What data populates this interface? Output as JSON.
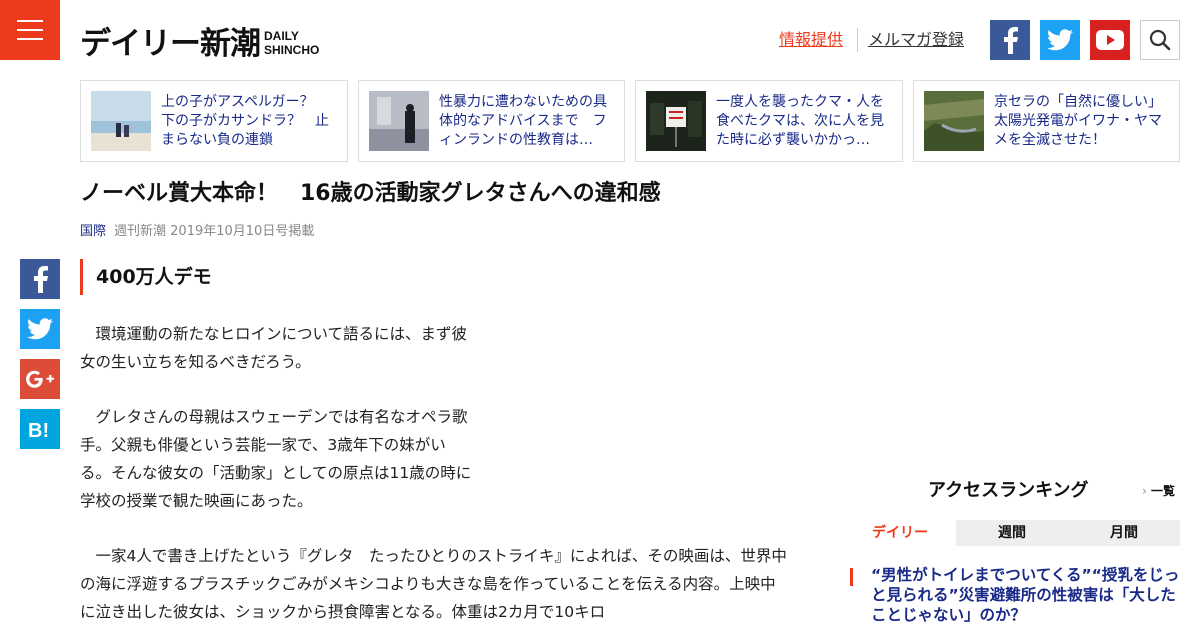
{
  "header": {
    "logo_jp": "デイリー新潮",
    "logo_en_1": "DAILY",
    "logo_en_2": "SHINCHO",
    "info_link": "情報提供",
    "newsletter_link": "メルマガ登録"
  },
  "related": [
    {
      "text": "上の子がアスペルガー？　下の子がカサンドラ？　止まらない負の連鎖"
    },
    {
      "text": "性暴力に遭わないための具体的なアドバイスまで　フィンランドの性教育は…"
    },
    {
      "text": "一度人を襲ったクマ・人を食べたクマは、次に人を見た時に必ず襲いかかっ…"
    },
    {
      "text": "京セラの「自然に優しい」太陽光発電がイワナ・ヤマメを全滅させた！"
    }
  ],
  "article": {
    "title": "ノーベル賞大本命！　16歳の活動家グレタさんへの違和感",
    "category": "国際",
    "source": "週刊新潮 2019年10月10日号掲載",
    "subhead": "400万人デモ",
    "paragraphs": [
      "　環境運動の新たなヒロインについて語るには、まず彼女の生い立ちを知るべきだろう。",
      "　グレタさんの母親はスウェーデンでは有名なオペラ歌手。父親も俳優という芸能一家で、3歳年下の妹がいる。そんな彼女の「活動家」としての原点は11歳の時に学校の授業で観た映画にあった。",
      "　一家4人で書き上げたという『グレタ　たったひとりのストライキ』によれば、その映画は、世界中の海に浮遊するプラスチックごみがメキシコよりも大きな島を作っていることを伝える内容。上映中に泣き出した彼女は、ショックから摂食障害となる。体重は2カ月で10キロ"
    ]
  },
  "ranking": {
    "title": "アクセスランキング",
    "all_link": "一覧",
    "tabs": [
      "デイリー",
      "週間",
      "月間"
    ],
    "top_item": "“男性がトイレまでついてくる”“授乳をじっと見られる”災害避難所の性被害は「大したことじゃない」のか？"
  },
  "colors": {
    "brand": "#ee3a1c",
    "link": "#1a2a88",
    "facebook": "#3b5998",
    "twitter": "#1da1f2",
    "youtube": "#d8201e",
    "googleplus": "#dd4b39",
    "hatena": "#00a4de"
  }
}
